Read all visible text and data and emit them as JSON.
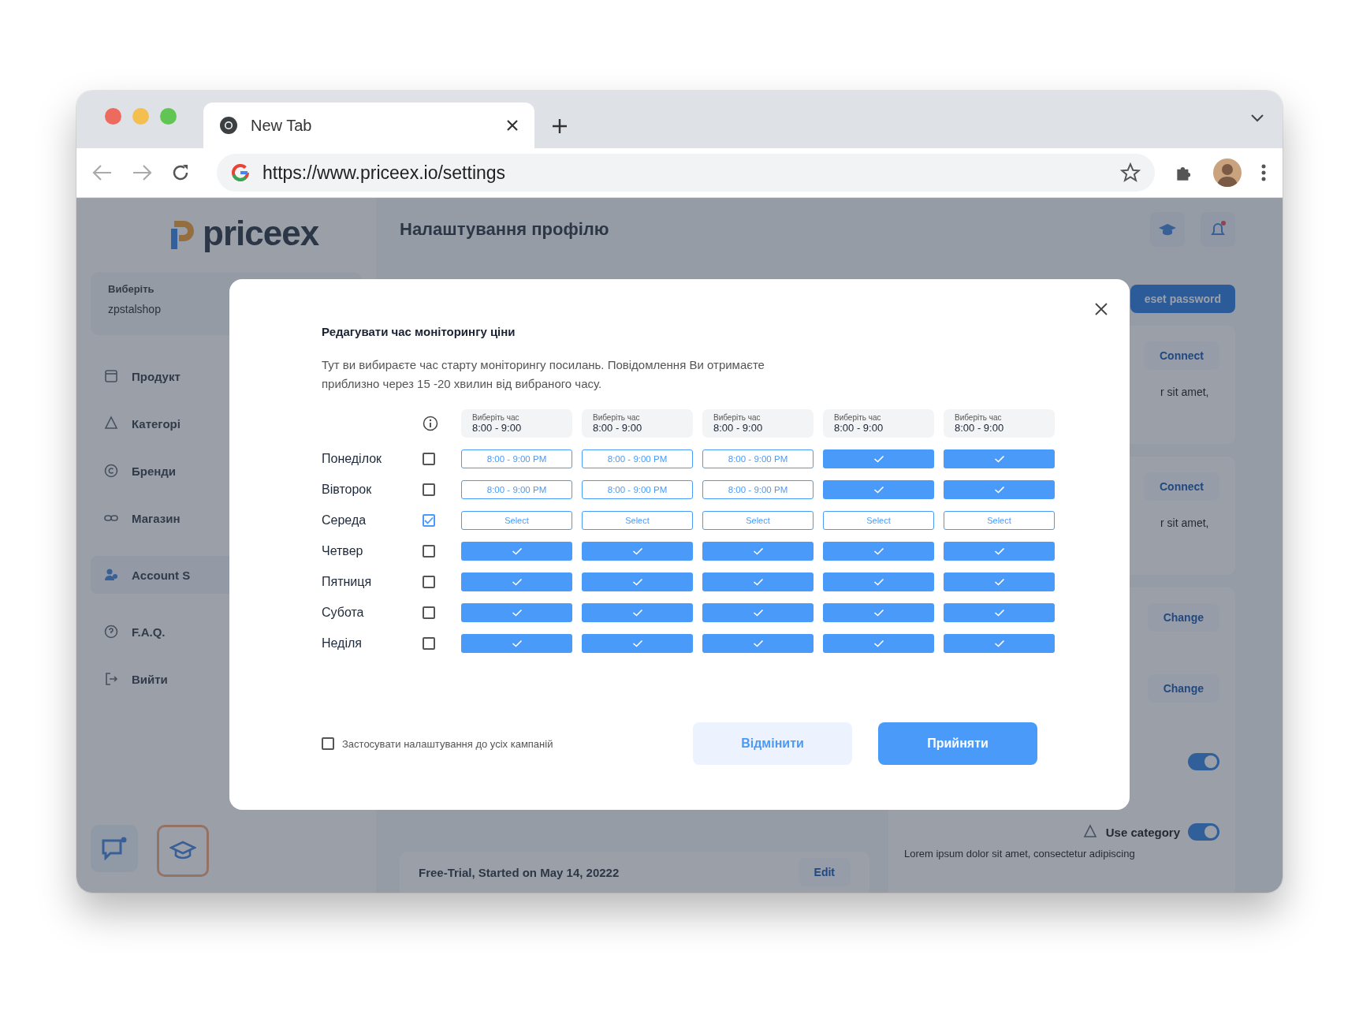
{
  "browser": {
    "tab_title": "New Tab",
    "url": "https://www.priceex.io/settings"
  },
  "page": {
    "logo": "priceex",
    "title": "Налаштування профілю",
    "shop_selector": {
      "label": "Виберіть",
      "value": "zpstalshop"
    },
    "sidebar": [
      {
        "label": "Продукт",
        "selected": false
      },
      {
        "label": "Категорі",
        "selected": false
      },
      {
        "label": "Бренди",
        "selected": false
      },
      {
        "label": "Магазин",
        "selected": false
      },
      {
        "label": "Account S",
        "selected": true
      },
      {
        "label": "F.A.Q.",
        "selected": false
      },
      {
        "label": "Вийти",
        "selected": false
      }
    ],
    "reset_button": "eset password",
    "cards": [
      {
        "button": "Connect",
        "text": "r sit amet,"
      },
      {
        "button": "Connect",
        "text": "r sit amet,"
      }
    ],
    "change_buttons": [
      "Change",
      "Change"
    ],
    "toggles": [
      {
        "on": true
      },
      {
        "on": true
      }
    ],
    "use_category": {
      "title": "Use category",
      "text": "Lorem ipsum dolor sit amet, consectetur adipiscing"
    },
    "trial": {
      "text": "Free-Trial, Started on May 14, 20222",
      "button": "Edit"
    }
  },
  "modal": {
    "title": "Редагувати час моніторингу ціни",
    "description": "Тут ви вибираєте час старту моніторингу посилань. Повідомлення Ви отримаєте приблизно через 15 -20 хвилин від вибраного часу.",
    "header_cells": [
      {
        "label": "Виберіть час",
        "value": "8:00 - 9:00"
      },
      {
        "label": "Виберіть час",
        "value": "8:00 - 9:00"
      },
      {
        "label": "Виберіть час",
        "value": "8:00 - 9:00"
      },
      {
        "label": "Виберіть час",
        "value": "8:00 - 9:00"
      },
      {
        "label": "Виберіть час",
        "value": "8:00 - 9:00"
      }
    ],
    "days": [
      {
        "name": "Понеділок",
        "checked": false,
        "slots": [
          {
            "kind": "time",
            "text": "8:00 - 9:00 PM"
          },
          {
            "kind": "time",
            "text": "8:00 - 9:00 PM"
          },
          {
            "kind": "time",
            "text": "8:00 - 9:00 PM"
          },
          {
            "kind": "check"
          },
          {
            "kind": "check"
          }
        ]
      },
      {
        "name": "Вівторок",
        "checked": false,
        "slots": [
          {
            "kind": "time",
            "text": "8:00 - 9:00 PM"
          },
          {
            "kind": "time",
            "text": "8:00 - 9:00 PM"
          },
          {
            "kind": "time",
            "text": "8:00 - 9:00 PM"
          },
          {
            "kind": "check"
          },
          {
            "kind": "check"
          }
        ]
      },
      {
        "name": "Середа",
        "checked": true,
        "slots": [
          {
            "kind": "select",
            "text": "Select"
          },
          {
            "kind": "select",
            "text": "Select"
          },
          {
            "kind": "select",
            "text": "Select"
          },
          {
            "kind": "select",
            "text": "Select"
          },
          {
            "kind": "select",
            "text": "Select"
          }
        ]
      },
      {
        "name": "Четвер",
        "checked": false,
        "slots": [
          {
            "kind": "check"
          },
          {
            "kind": "check"
          },
          {
            "kind": "check"
          },
          {
            "kind": "check"
          },
          {
            "kind": "check"
          }
        ]
      },
      {
        "name": "Пятниця",
        "checked": false,
        "slots": [
          {
            "kind": "check"
          },
          {
            "kind": "check"
          },
          {
            "kind": "check"
          },
          {
            "kind": "check"
          },
          {
            "kind": "check"
          }
        ]
      },
      {
        "name": "Субота",
        "checked": false,
        "slots": [
          {
            "kind": "check"
          },
          {
            "kind": "check"
          },
          {
            "kind": "check"
          },
          {
            "kind": "check"
          },
          {
            "kind": "check"
          }
        ]
      },
      {
        "name": "Неділя",
        "checked": false,
        "slots": [
          {
            "kind": "check"
          },
          {
            "kind": "check"
          },
          {
            "kind": "check"
          },
          {
            "kind": "check"
          },
          {
            "kind": "check"
          }
        ]
      }
    ],
    "apply_all": {
      "label": "Застосувати налаштування до усіх кампаній",
      "checked": false
    },
    "cancel_button": "Відмінити",
    "accept_button": "Прийняти"
  }
}
